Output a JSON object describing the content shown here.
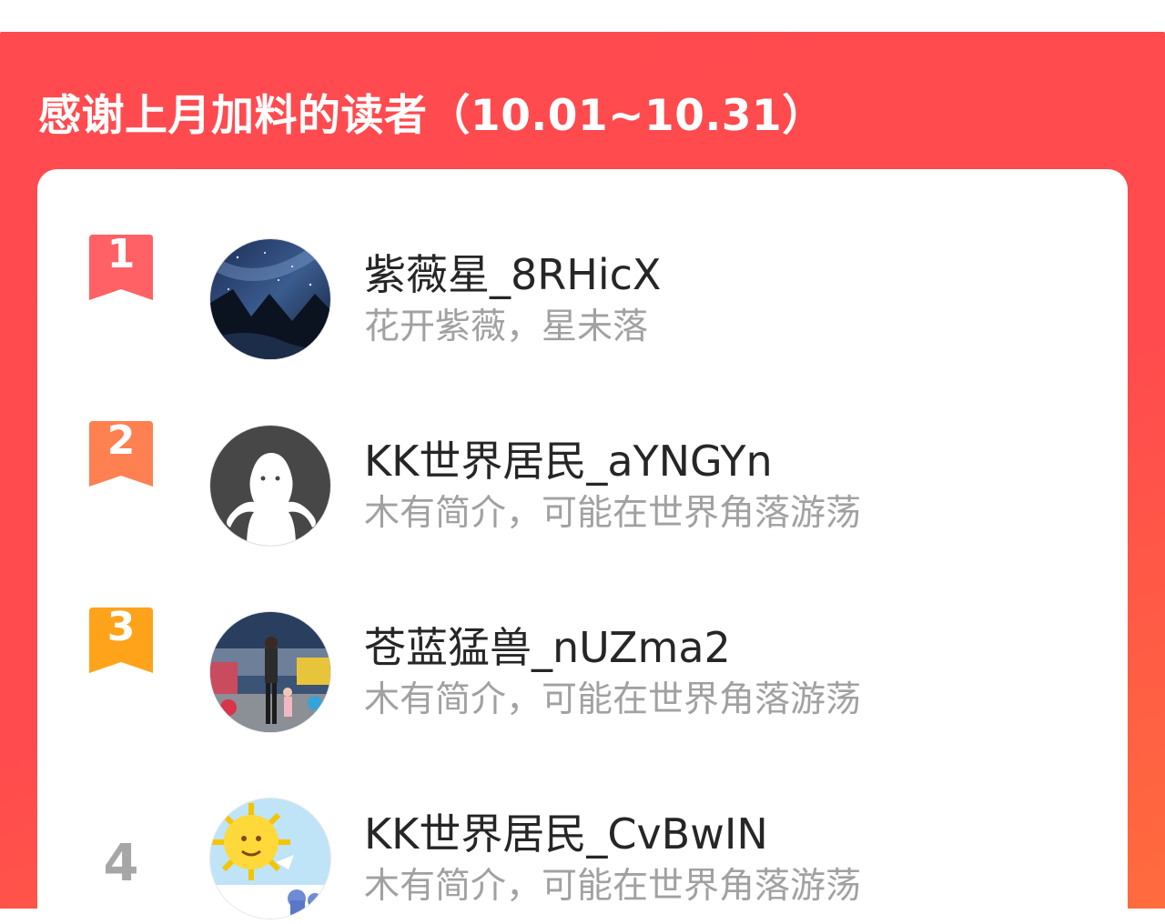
{
  "header": {
    "title": "感谢上月加料的读者（10.01~10.31）"
  },
  "colors": {
    "panel_red": "#ff4a4e",
    "panel_orange": "#ff6c3d",
    "rank1": "#ff5a5f",
    "rank2": "#ff7f4f",
    "rank3": "#ffa31a",
    "rank_plain": "#a6a6a6"
  },
  "readers": [
    {
      "rank": "1",
      "name": "紫薇星_8RHicX",
      "bio": "花开紫薇，星未落",
      "avatar": "night-sky-mountains-photo"
    },
    {
      "rank": "2",
      "name": "KK世界居民_aYNGYn",
      "bio": "木有简介，可能在世界角落游荡",
      "avatar": "default-ghost-avatar"
    },
    {
      "rank": "3",
      "name": "苍蓝猛兽_nUZma2",
      "bio": "木有简介，可能在世界角落游荡",
      "avatar": "amusement-park-photo"
    },
    {
      "rank": "4",
      "name": "KK世界居民_CvBwIN",
      "bio": "木有简介，可能在世界角落游荡",
      "avatar": "cartoon-sun-photo"
    }
  ]
}
